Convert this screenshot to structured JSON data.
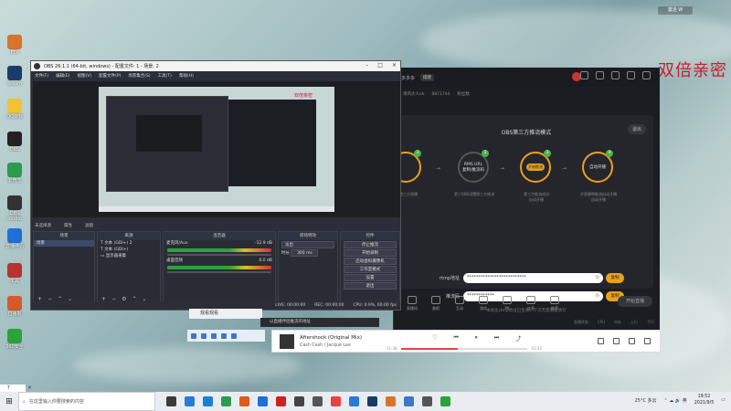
{
  "watermark": "双倍亲密",
  "activation": "激活 W",
  "desktop_icons": [
    {
      "label": "FTP",
      "color": "#d8742b"
    },
    {
      "label": "Steam",
      "color": "#1b3c6b"
    },
    {
      "label": "QQ游戏",
      "color": "#f1c232"
    },
    {
      "label": "OBS",
      "color": "#222222"
    },
    {
      "label": "爱奇艺",
      "color": "#2d9b4e"
    },
    {
      "label": "OBS Studio",
      "color": "#333333"
    },
    {
      "label": "直播伴侣",
      "color": "#1f6fd8"
    },
    {
      "label": "工具",
      "color": "#b93232"
    },
    {
      "label": "直播姬",
      "color": "#d85a2b"
    },
    {
      "label": "360安全",
      "color": "#2aa33a"
    }
  ],
  "assistant": {
    "tab": "多多多",
    "tag": "搭建",
    "sub": [
      "清风大人ok",
      "8871744",
      "粉丝数"
    ],
    "panel_title": "OBS第三方推流模式",
    "back": "退出",
    "steps": [
      {
        "num": "1",
        "text": ""
      },
      {
        "num": "2",
        "text": "RMS URL\n复制/推流码"
      },
      {
        "num": "3",
        "text": "开始推流"
      },
      {
        "num": "4",
        "text": "自动开播"
      }
    ],
    "captions": [
      "在第三方直播",
      "第三OBS设置第三方推流",
      "第三方推流成功\n自动开播",
      "开直播将推流自动开播\n自动开播"
    ],
    "rtmp_label": "rtmp地址",
    "rtmp_value": "**************************",
    "key_label": "推流码",
    "key_value": "************",
    "hide": "隐",
    "copy": "复制",
    "hint": "本地化rtmp地址已生效，下次无需重复填写",
    "tools": [
      "直播间",
      "美颜",
      "互动",
      "游戏",
      "PK",
      "连麦",
      "推荐"
    ],
    "start": "开始直播",
    "status": [
      "直播状态",
      "CPU",
      "内存",
      "上行",
      "下行"
    ]
  },
  "obs": {
    "title": "OBS 26.1.1 (64-bit, windows) - 配置文件: 1 - 场景: 2",
    "menu": [
      "文件(F)",
      "编辑(E)",
      "视图(V)",
      "配置文件(P)",
      "场景集合(S)",
      "工具(T)",
      "帮助(H)"
    ],
    "preview_watermark": "双倍亲密",
    "scene_info": [
      "未选择源",
      "属性",
      "滤镜"
    ],
    "docks": {
      "scenes": {
        "title": "场景",
        "items": [
          "场景"
        ]
      },
      "sources": {
        "title": "来源",
        "items": [
          "文本 (GDI+) 2",
          "文本 (GDI+)",
          "显示器采集"
        ]
      },
      "mixer": {
        "title": "混音器",
        "channels": [
          {
            "name": "麦克风/Aux",
            "db": "-12.9 dB"
          },
          {
            "name": "桌面音频",
            "db": "0.0 dB"
          }
        ]
      },
      "transitions": {
        "title": "转场特效",
        "type": "淡出",
        "duration_label": "时长",
        "duration": "300 ms"
      },
      "controls": {
        "title": "控件",
        "buttons": [
          "停止推流",
          "开始录制",
          "启动虚拟摄像机",
          "工作室模式",
          "设置",
          "退出"
        ]
      }
    },
    "status": [
      "LIVE: 00:00:00",
      "REC: 00:00:00",
      "CPU: 0.9%, 60.00 fps"
    ]
  },
  "float_window": "观看观看",
  "tip": "以直播伴侣推流的地址",
  "music": {
    "song": "Aftershock (Original Mix)",
    "artist": "Cash Cash / Jacque Lee",
    "time_elapsed": "01:38",
    "time_total": "03:22",
    "progress": 0.45
  },
  "taskbar": {
    "search_placeholder": "在这里输入你要搜索的内容",
    "weather": "25°C 多云",
    "time": "19:52",
    "date": "2021/9/5",
    "apps": [
      "#3a3a3a",
      "#2a7ad8",
      "#1b7fd6",
      "#2d9b4e",
      "#e05a1c",
      "#1f6fd8",
      "#c22",
      "#444",
      "#555",
      "#ec4141",
      "#2a7ad8",
      "#1b3c6b",
      "#d8742b",
      "#3a78c9",
      "#555",
      "#2aa33a"
    ]
  },
  "notify": "T"
}
